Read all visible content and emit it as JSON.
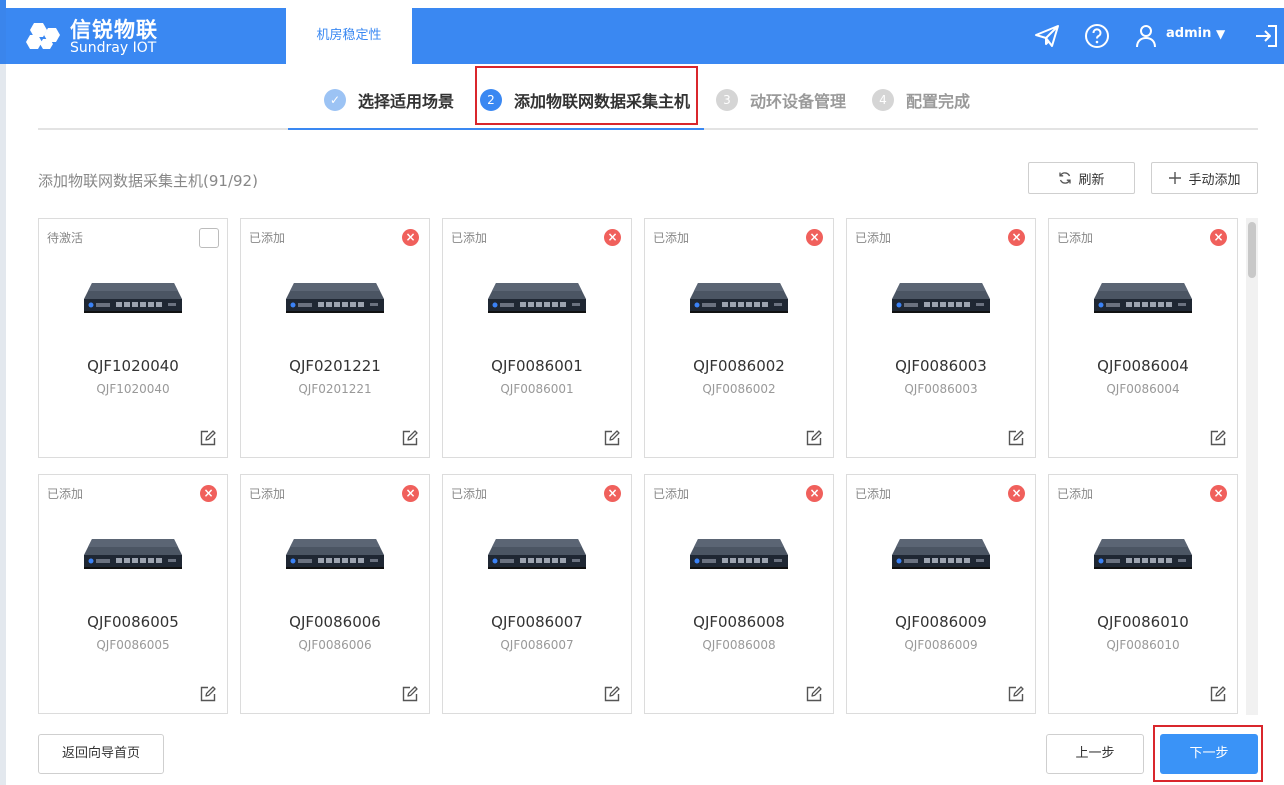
{
  "header": {
    "brand_cn": "信锐物联",
    "brand_en": "Sundray IOT",
    "nav_tab": "机房稳定性",
    "user": "admin",
    "accent": "#3a88f2"
  },
  "steps": [
    {
      "index": "✓",
      "label": "选择适用场景",
      "state": "done"
    },
    {
      "index": "2",
      "label": "添加物联网数据采集主机",
      "state": "active"
    },
    {
      "index": "3",
      "label": "动环设备管理",
      "state": "todo"
    },
    {
      "index": "4",
      "label": "配置完成",
      "state": "todo"
    }
  ],
  "section": {
    "title": "添加物联网数据采集主机(91/92)",
    "refresh": "刷新",
    "manual_add": "手动添加"
  },
  "cards": [
    {
      "status": "待激活",
      "name": "QJF1020040",
      "sub": "QJF1020040",
      "added": false
    },
    {
      "status": "已添加",
      "name": "QJF0201221",
      "sub": "QJF0201221",
      "added": true
    },
    {
      "status": "已添加",
      "name": "QJF0086001",
      "sub": "QJF0086001",
      "added": true
    },
    {
      "status": "已添加",
      "name": "QJF0086002",
      "sub": "QJF0086002",
      "added": true
    },
    {
      "status": "已添加",
      "name": "QJF0086003",
      "sub": "QJF0086003",
      "added": true
    },
    {
      "status": "已添加",
      "name": "QJF0086004",
      "sub": "QJF0086004",
      "added": true
    },
    {
      "status": "已添加",
      "name": "QJF0086005",
      "sub": "QJF0086005",
      "added": true
    },
    {
      "status": "已添加",
      "name": "QJF0086006",
      "sub": "QJF0086006",
      "added": true
    },
    {
      "status": "已添加",
      "name": "QJF0086007",
      "sub": "QJF0086007",
      "added": true
    },
    {
      "status": "已添加",
      "name": "QJF0086008",
      "sub": "QJF0086008",
      "added": true
    },
    {
      "status": "已添加",
      "name": "QJF0086009",
      "sub": "QJF0086009",
      "added": true
    },
    {
      "status": "已添加",
      "name": "QJF0086010",
      "sub": "QJF0086010",
      "added": true
    }
  ],
  "footer": {
    "back": "返回向导首页",
    "prev": "上一步",
    "next": "下一步"
  }
}
